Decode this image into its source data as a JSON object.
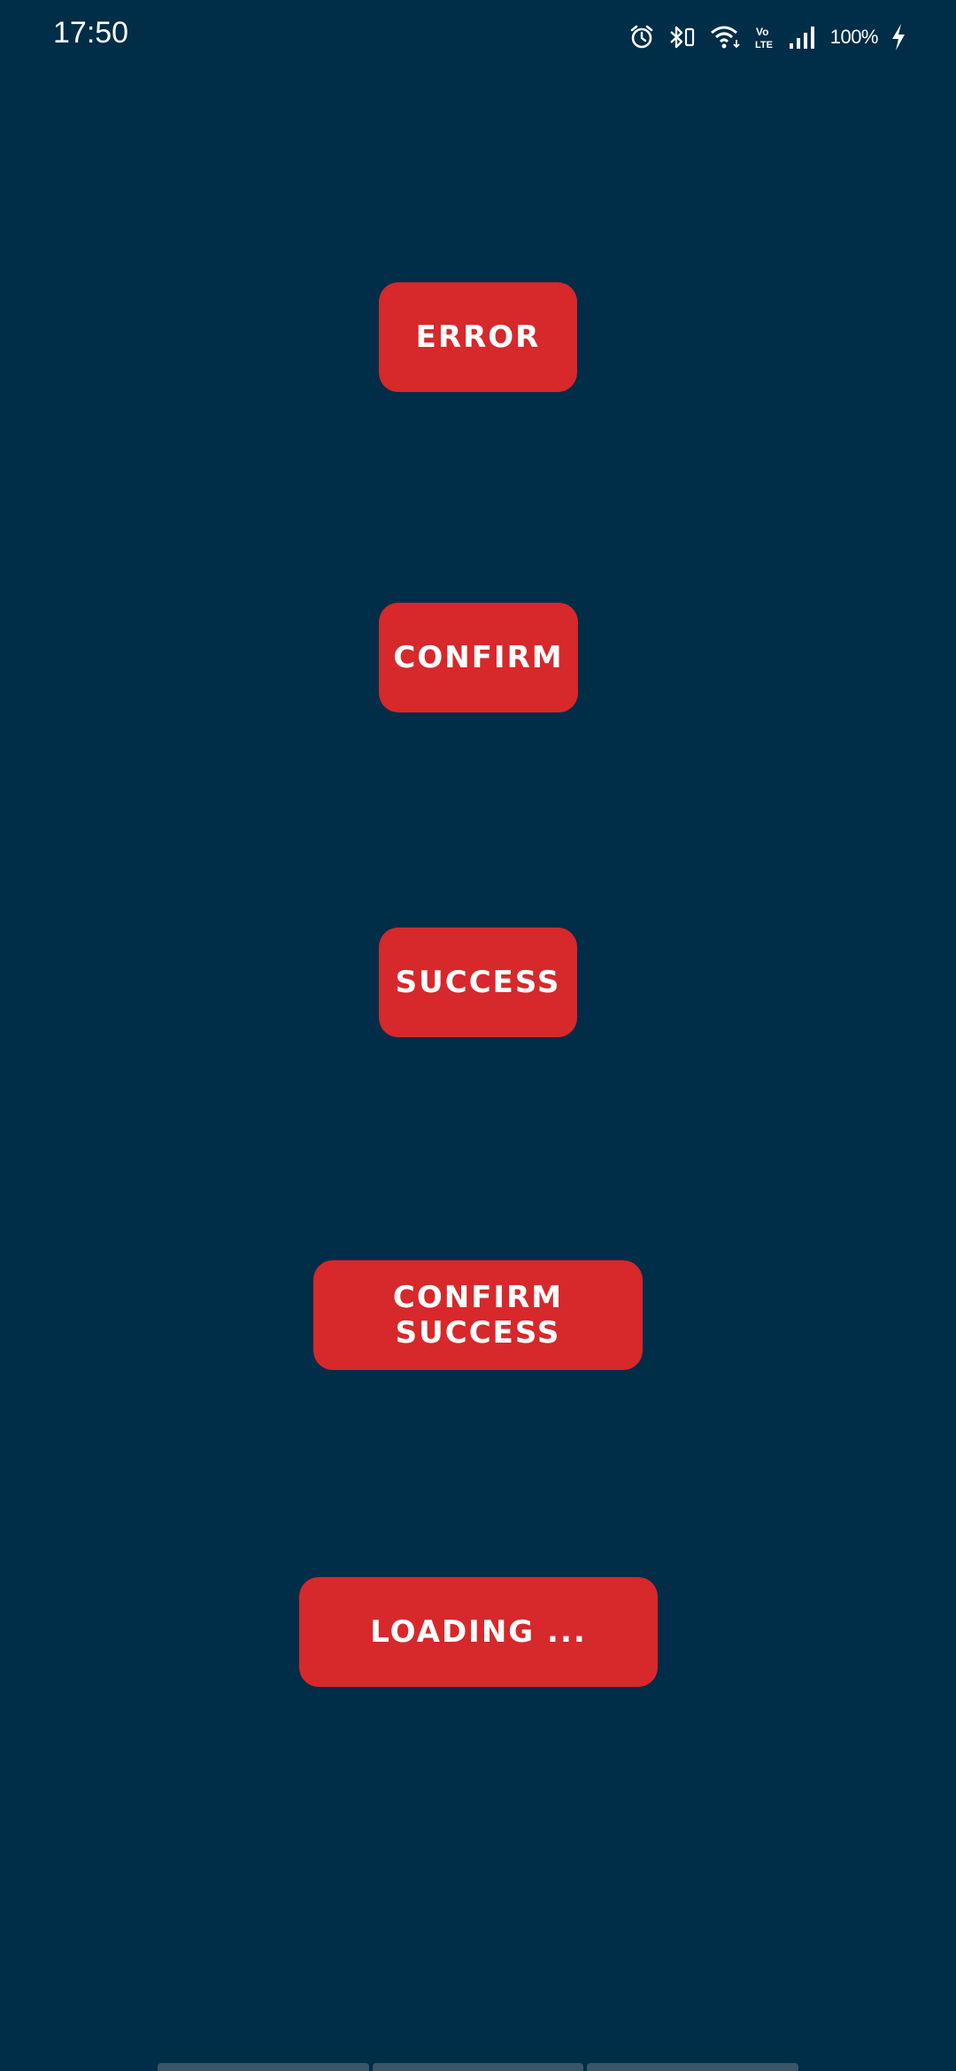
{
  "status_bar": {
    "time": "17:50",
    "battery_percent": "100%",
    "icons": [
      "alarm-icon",
      "bluetooth-icon",
      "wifi-icon",
      "volte-icon",
      "signal-icon",
      "charging-icon"
    ]
  },
  "buttons": {
    "error_label": "ERROR",
    "confirm_label": "CONFIRM",
    "success_label": "SUCCESS",
    "confirm_success_label": "CONFIRM SUCCESS",
    "loading_label": "LOADING ..."
  },
  "colors": {
    "background": "#002d47",
    "button": "#d7282b",
    "text": "#ffffff"
  }
}
